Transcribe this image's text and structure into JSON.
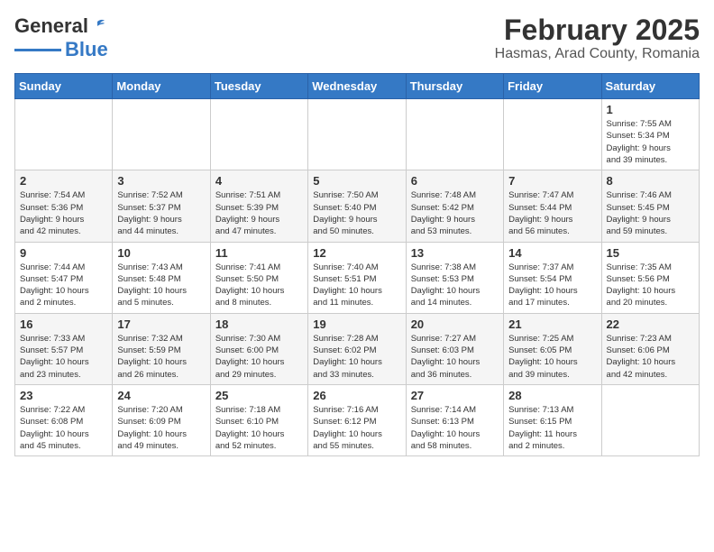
{
  "logo": {
    "general": "General",
    "blue": "Blue"
  },
  "header": {
    "month": "February 2025",
    "location": "Hasmas, Arad County, Romania"
  },
  "weekdays": [
    "Sunday",
    "Monday",
    "Tuesday",
    "Wednesday",
    "Thursday",
    "Friday",
    "Saturday"
  ],
  "weeks": [
    [
      {
        "day": "",
        "info": ""
      },
      {
        "day": "",
        "info": ""
      },
      {
        "day": "",
        "info": ""
      },
      {
        "day": "",
        "info": ""
      },
      {
        "day": "",
        "info": ""
      },
      {
        "day": "",
        "info": ""
      },
      {
        "day": "1",
        "info": "Sunrise: 7:55 AM\nSunset: 5:34 PM\nDaylight: 9 hours\nand 39 minutes."
      }
    ],
    [
      {
        "day": "2",
        "info": "Sunrise: 7:54 AM\nSunset: 5:36 PM\nDaylight: 9 hours\nand 42 minutes."
      },
      {
        "day": "3",
        "info": "Sunrise: 7:52 AM\nSunset: 5:37 PM\nDaylight: 9 hours\nand 44 minutes."
      },
      {
        "day": "4",
        "info": "Sunrise: 7:51 AM\nSunset: 5:39 PM\nDaylight: 9 hours\nand 47 minutes."
      },
      {
        "day": "5",
        "info": "Sunrise: 7:50 AM\nSunset: 5:40 PM\nDaylight: 9 hours\nand 50 minutes."
      },
      {
        "day": "6",
        "info": "Sunrise: 7:48 AM\nSunset: 5:42 PM\nDaylight: 9 hours\nand 53 minutes."
      },
      {
        "day": "7",
        "info": "Sunrise: 7:47 AM\nSunset: 5:44 PM\nDaylight: 9 hours\nand 56 minutes."
      },
      {
        "day": "8",
        "info": "Sunrise: 7:46 AM\nSunset: 5:45 PM\nDaylight: 9 hours\nand 59 minutes."
      }
    ],
    [
      {
        "day": "9",
        "info": "Sunrise: 7:44 AM\nSunset: 5:47 PM\nDaylight: 10 hours\nand 2 minutes."
      },
      {
        "day": "10",
        "info": "Sunrise: 7:43 AM\nSunset: 5:48 PM\nDaylight: 10 hours\nand 5 minutes."
      },
      {
        "day": "11",
        "info": "Sunrise: 7:41 AM\nSunset: 5:50 PM\nDaylight: 10 hours\nand 8 minutes."
      },
      {
        "day": "12",
        "info": "Sunrise: 7:40 AM\nSunset: 5:51 PM\nDaylight: 10 hours\nand 11 minutes."
      },
      {
        "day": "13",
        "info": "Sunrise: 7:38 AM\nSunset: 5:53 PM\nDaylight: 10 hours\nand 14 minutes."
      },
      {
        "day": "14",
        "info": "Sunrise: 7:37 AM\nSunset: 5:54 PM\nDaylight: 10 hours\nand 17 minutes."
      },
      {
        "day": "15",
        "info": "Sunrise: 7:35 AM\nSunset: 5:56 PM\nDaylight: 10 hours\nand 20 minutes."
      }
    ],
    [
      {
        "day": "16",
        "info": "Sunrise: 7:33 AM\nSunset: 5:57 PM\nDaylight: 10 hours\nand 23 minutes."
      },
      {
        "day": "17",
        "info": "Sunrise: 7:32 AM\nSunset: 5:59 PM\nDaylight: 10 hours\nand 26 minutes."
      },
      {
        "day": "18",
        "info": "Sunrise: 7:30 AM\nSunset: 6:00 PM\nDaylight: 10 hours\nand 29 minutes."
      },
      {
        "day": "19",
        "info": "Sunrise: 7:28 AM\nSunset: 6:02 PM\nDaylight: 10 hours\nand 33 minutes."
      },
      {
        "day": "20",
        "info": "Sunrise: 7:27 AM\nSunset: 6:03 PM\nDaylight: 10 hours\nand 36 minutes."
      },
      {
        "day": "21",
        "info": "Sunrise: 7:25 AM\nSunset: 6:05 PM\nDaylight: 10 hours\nand 39 minutes."
      },
      {
        "day": "22",
        "info": "Sunrise: 7:23 AM\nSunset: 6:06 PM\nDaylight: 10 hours\nand 42 minutes."
      }
    ],
    [
      {
        "day": "23",
        "info": "Sunrise: 7:22 AM\nSunset: 6:08 PM\nDaylight: 10 hours\nand 45 minutes."
      },
      {
        "day": "24",
        "info": "Sunrise: 7:20 AM\nSunset: 6:09 PM\nDaylight: 10 hours\nand 49 minutes."
      },
      {
        "day": "25",
        "info": "Sunrise: 7:18 AM\nSunset: 6:10 PM\nDaylight: 10 hours\nand 52 minutes."
      },
      {
        "day": "26",
        "info": "Sunrise: 7:16 AM\nSunset: 6:12 PM\nDaylight: 10 hours\nand 55 minutes."
      },
      {
        "day": "27",
        "info": "Sunrise: 7:14 AM\nSunset: 6:13 PM\nDaylight: 10 hours\nand 58 minutes."
      },
      {
        "day": "28",
        "info": "Sunrise: 7:13 AM\nSunset: 6:15 PM\nDaylight: 11 hours\nand 2 minutes."
      },
      {
        "day": "",
        "info": ""
      }
    ]
  ]
}
